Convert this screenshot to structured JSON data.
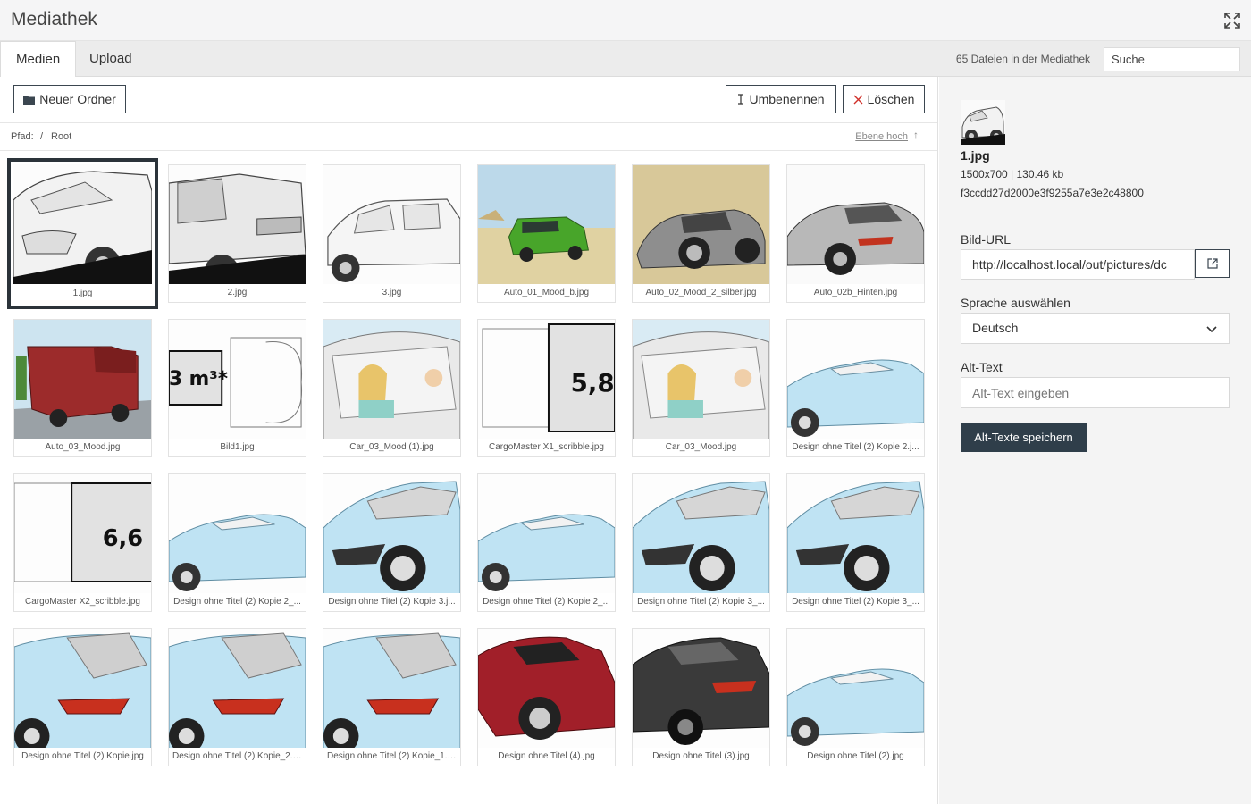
{
  "window": {
    "title": "Mediathek"
  },
  "tabs": [
    {
      "label": "Medien",
      "active": true
    },
    {
      "label": "Upload",
      "active": false
    }
  ],
  "file_count": "65 Dateien in der Mediathek",
  "search": {
    "placeholder": "Suche",
    "value": ""
  },
  "toolbar": {
    "new_folder": "Neuer Ordner",
    "rename": "Umbenennen",
    "delete": "Löschen"
  },
  "path": {
    "label": "Pfad:",
    "separator": "/",
    "root": "Root",
    "level_up": "Ebene hoch"
  },
  "files": [
    {
      "name": "1.jpg",
      "selected": true,
      "art": "sketch-suv-front"
    },
    {
      "name": "2.jpg",
      "art": "sketch-suv-side"
    },
    {
      "name": "3.jpg",
      "art": "sketch-car-side"
    },
    {
      "name": "Auto_01_Mood_b.jpg",
      "art": "green-suv"
    },
    {
      "name": "Auto_02_Mood_2_silber.jpg",
      "art": "silver-coupe"
    },
    {
      "name": "Auto_02b_Hinten.jpg",
      "art": "silver-coupe-rear"
    },
    {
      "name": "Auto_03_Mood.jpg",
      "art": "red-van"
    },
    {
      "name": "Bild1.jpg",
      "art": "cargo-m3"
    },
    {
      "name": "Car_03_Mood (1).jpg",
      "art": "car-people"
    },
    {
      "name": "CargoMaster X1_scribble.jpg",
      "art": "cargo-58"
    },
    {
      "name": "Car_03_Mood.jpg",
      "art": "car-people"
    },
    {
      "name": "Design ohne Titel (2) Kopie 2.j...",
      "art": "blue-side"
    },
    {
      "name": "CargoMaster X2_scribble.jpg",
      "art": "cargo-66"
    },
    {
      "name": "Design ohne Titel (2) Kopie 2_...",
      "art": "blue-side"
    },
    {
      "name": "Design ohne Titel (2) Kopie 3.j...",
      "art": "blue-front"
    },
    {
      "name": "Design ohne Titel (2) Kopie 2_...",
      "art": "blue-side"
    },
    {
      "name": "Design ohne Titel (2) Kopie 3_...",
      "art": "blue-front"
    },
    {
      "name": "Design ohne Titel (2) Kopie 3_...",
      "art": "blue-front"
    },
    {
      "name": "Design ohne Titel (2) Kopie.jpg",
      "art": "blue-rear"
    },
    {
      "name": "Design ohne Titel (2) Kopie_2.j...",
      "art": "blue-rear"
    },
    {
      "name": "Design ohne Titel (2) Kopie_1.j...",
      "art": "blue-rear"
    },
    {
      "name": "Design ohne Titel (4).jpg",
      "art": "red-coupe"
    },
    {
      "name": "Design ohne Titel (3).jpg",
      "art": "black-coupe"
    },
    {
      "name": "Design ohne Titel (2).jpg",
      "art": "blue-side"
    }
  ],
  "details": {
    "file_name": "1.jpg",
    "meta": "1500x700 | 130.46 kb",
    "hash": "f3ccdd27d2000e3f9255a7e3e2c48800",
    "url_label": "Bild-URL",
    "url_value": "http://localhost.local/out/pictures/dc",
    "language_label": "Sprache auswählen",
    "language_value": "Deutsch",
    "alt_label": "Alt-Text",
    "alt_placeholder": "Alt-Text eingeben",
    "save_button": "Alt-Texte speichern"
  }
}
